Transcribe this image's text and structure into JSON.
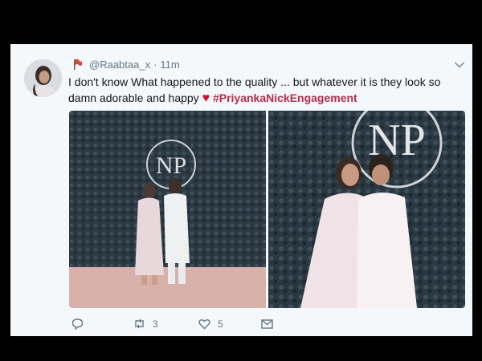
{
  "tweet": {
    "handle": "@Raabtaa_x",
    "separator": "·",
    "time": "11m",
    "text_main": "I don't know What happened to the quality ... but whatever it is they look so damn adorable and happy",
    "emoji": "♥",
    "hashtag": "#PriyankaNickEngagement",
    "logo_text": "NP",
    "actions": {
      "reply_count": "",
      "retweet_count": "3",
      "like_count": "5"
    }
  },
  "colors": {
    "hashtag": "#b52c4e",
    "heart": "#c8102e",
    "muted": "#657786",
    "card_bg": "#f5f8fa"
  },
  "icons": [
    "flag-icon",
    "chevron-down-icon",
    "reply-icon",
    "retweet-icon",
    "like-icon",
    "message-icon"
  ]
}
